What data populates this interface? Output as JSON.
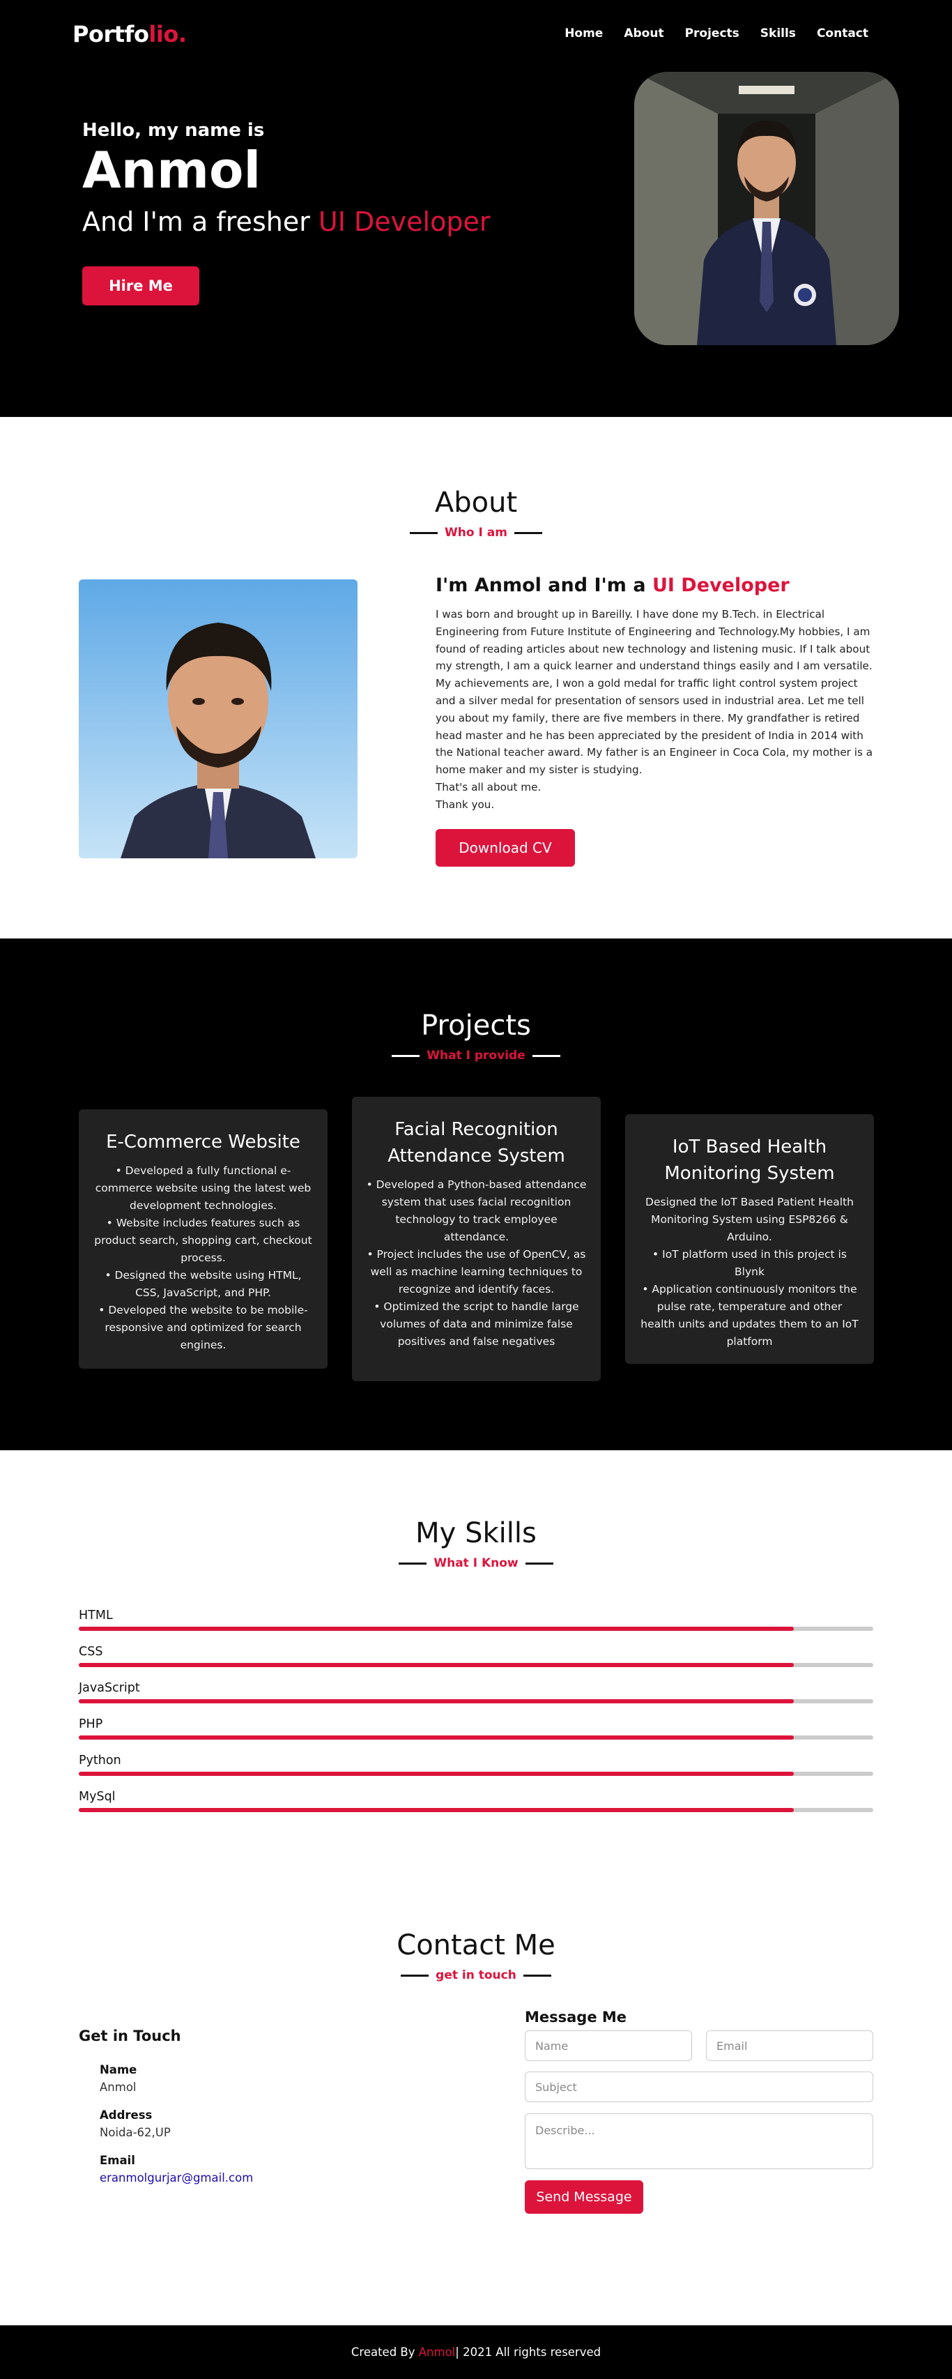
{
  "nav": {
    "logo_main": "Portfo",
    "logo_accent": "lio.",
    "items": [
      "Home",
      "About",
      "Projects",
      "Skills",
      "Contact"
    ]
  },
  "hero": {
    "hello": "Hello, my name is",
    "name": "Anmol",
    "role_prefix": "And I'm a fresher ",
    "role_accent": "UI Developer",
    "button": "Hire Me"
  },
  "about": {
    "title": "About",
    "subtitle": "Who I am",
    "heading_prefix": "I'm Anmol and I'm a ",
    "heading_accent": "UI Developer",
    "paragraph": "I was born and brought up in Bareilly. I have done my B.Tech. in Electrical Engineering from Future Institute of Engineering and Technology.My hobbies, I am found of reading articles about new technology and listening music. If I talk about my strength, I am a quick learner and understand things easily and I am versatile. My achievements are, I won a gold medal for traffic light control system project and a silver medal for presentation of sensors used in industrial area. Let me tell you about my family, there are five members in there. My grandfather is retired head master and he has been appreciated by the president of India in 2014 with the National teacher award. My father is an Engineer in Coca Cola, my mother is a home maker and my sister is studying.",
    "closing": "That's all about me.",
    "thanks": "Thank you.",
    "button": "Download CV"
  },
  "projects": {
    "title": "Projects",
    "subtitle": "What I provide",
    "cards": [
      {
        "title": "E-Commerce Website",
        "desc": "• Developed a fully functional e-commerce website using the latest web development technologies.\n• Website includes features such as product search, shopping cart, checkout process.\n• Designed the website using HTML, CSS, JavaScript, and PHP.\n• Developed the website to be mobile-responsive and optimized for search engines."
      },
      {
        "title": "Facial Recognition Attendance System",
        "desc": "• Developed a Python-based attendance system that uses facial recognition technology to track employee attendance.\n• Project includes the use of OpenCV, as well as machine learning techniques to recognize and identify faces.\n• Optimized the script to handle large volumes of data and minimize false positives and false negatives"
      },
      {
        "title": "IoT Based Health Monitoring System",
        "desc": "Designed the IoT Based Patient Health Monitoring System using ESP8266 & Arduino.\n• IoT platform used in this project is Blynk\n• Application continuously monitors the pulse rate, temperature and other health units and updates them to an IoT platform"
      }
    ]
  },
  "skills": {
    "title": "My Skills",
    "subtitle": "What I Know",
    "items": [
      {
        "name": "HTML",
        "level": 0.9
      },
      {
        "name": "CSS",
        "level": 0.9
      },
      {
        "name": "JavaScript",
        "level": 0.9
      },
      {
        "name": "PHP",
        "level": 0.9
      },
      {
        "name": "Python",
        "level": 0.9
      },
      {
        "name": "MySql",
        "level": 0.9
      }
    ]
  },
  "contact": {
    "title": "Contact Me",
    "subtitle": "get in touch",
    "info_title": "Get in Touch",
    "name_label": "Name",
    "name_value": "Anmol",
    "address_label": "Address",
    "address_value": "Noida-62,UP",
    "email_label": "Email",
    "email_value": "eranmolgurjar@gmail.com",
    "form_title": "Message Me",
    "name_placeholder": "Name",
    "email_placeholder": "Email",
    "subject_placeholder": "Subject",
    "describe_placeholder": "Describe...",
    "button": "Send Message"
  },
  "footer": {
    "prefix": "Created By ",
    "accent": "Anmol",
    "suffix": " | 2021 All rights reserved"
  },
  "colors": {
    "accent": "#dc143c",
    "dark_bg": "#000000",
    "card_bg": "#222222"
  }
}
